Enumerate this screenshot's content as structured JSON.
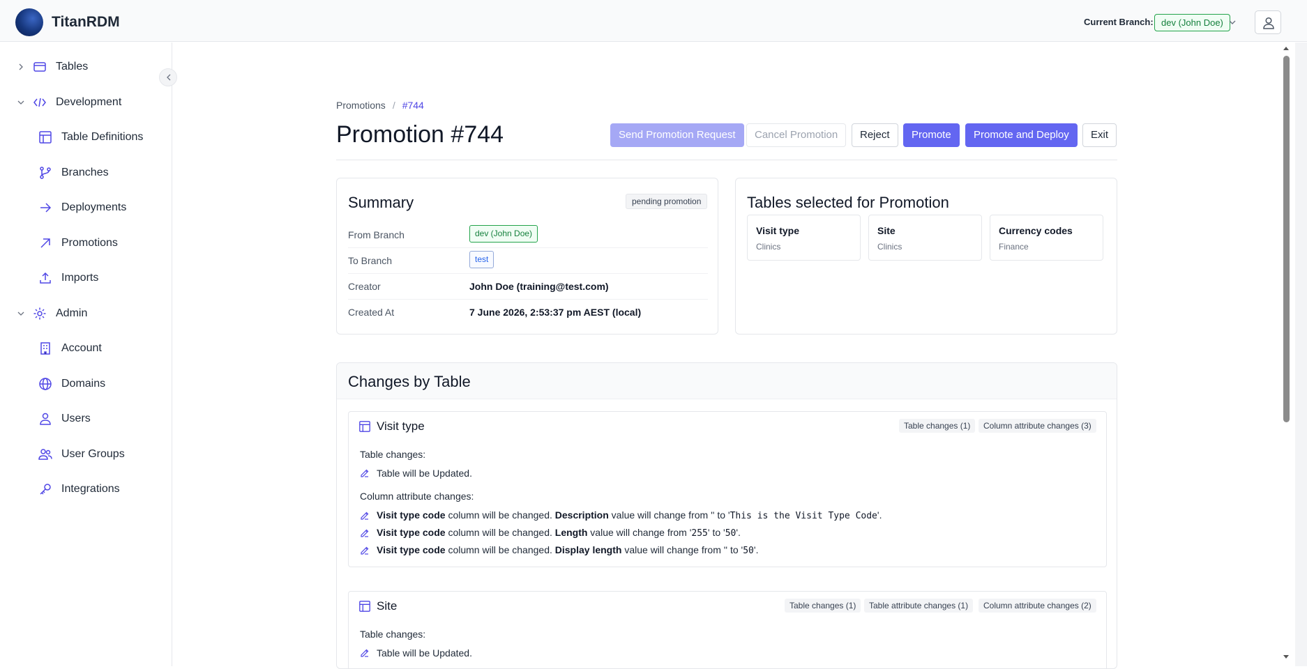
{
  "app": {
    "brand": "TitanRDM"
  },
  "header": {
    "current_branch_label": "Current Branch:",
    "current_branch_value": "dev (John Doe)"
  },
  "sidebar": {
    "items": [
      {
        "label": "Tables",
        "icon": "table-icon"
      },
      {
        "label": "Development",
        "icon": "code-icon"
      },
      {
        "label": "Table Definitions",
        "icon": "table-grid-icon"
      },
      {
        "label": "Branches",
        "icon": "git-branch-icon"
      },
      {
        "label": "Deployments",
        "icon": "arrow-right-icon"
      },
      {
        "label": "Promotions",
        "icon": "arrow-up-right-icon"
      },
      {
        "label": "Imports",
        "icon": "upload-icon"
      },
      {
        "label": "Admin",
        "icon": "gear-icon"
      },
      {
        "label": "Account",
        "icon": "building-icon"
      },
      {
        "label": "Domains",
        "icon": "globe-icon"
      },
      {
        "label": "Users",
        "icon": "user-icon"
      },
      {
        "label": "User Groups",
        "icon": "users-icon"
      },
      {
        "label": "Integrations",
        "icon": "key-icon"
      }
    ]
  },
  "breadcrumb": {
    "parent": "Promotions",
    "sep": "/",
    "current": "#744"
  },
  "page": {
    "title": "Promotion #744"
  },
  "actions": {
    "send": "Send Promotion Request",
    "cancel": "Cancel Promotion",
    "reject": "Reject",
    "promote": "Promote",
    "promote_deploy": "Promote and Deploy",
    "exit": "Exit"
  },
  "summary": {
    "title": "Summary",
    "status": "pending promotion",
    "rows": [
      {
        "key": "From Branch",
        "value": "dev (John Doe)"
      },
      {
        "key": "To Branch",
        "value": "test"
      },
      {
        "key": "Creator",
        "value": "John Doe (training@test.com)"
      },
      {
        "key": "Created At",
        "value": "7 June 2026, 2:53:37 pm AEST (local)"
      }
    ]
  },
  "selected_tables": {
    "title": "Tables selected for Promotion",
    "tables": [
      {
        "name": "Visit type",
        "domain": "Clinics"
      },
      {
        "name": "Site",
        "domain": "Clinics"
      },
      {
        "name": "Currency codes",
        "domain": "Finance"
      }
    ]
  },
  "changes": {
    "title": "Changes by Table",
    "tables": [
      {
        "name": "Visit type",
        "pills": [
          "Table changes (1)",
          "Column attribute changes (3)"
        ],
        "table_changes_label": "Table changes:",
        "table_changes": [
          "Table will be Updated."
        ],
        "column_changes_label": "Column attribute changes:",
        "column_changes": [
          {
            "column": "Visit type code",
            "mid": " column will be changed. ",
            "attr": "Description",
            "pre": " value will change from '",
            "from": "",
            "to_sep": "' to '",
            "to": "This is the Visit Type Code",
            "end": "'."
          },
          {
            "column": "Visit type code",
            "mid": " column will be changed. ",
            "attr": "Length",
            "pre": " value will change from '",
            "from": "255",
            "to_sep": "' to '",
            "to": "50",
            "end": "'."
          },
          {
            "column": "Visit type code",
            "mid": " column will be changed. ",
            "attr": "Display length",
            "pre": " value will change from '",
            "from": "",
            "to_sep": "' to '",
            "to": "50",
            "end": "'."
          }
        ]
      },
      {
        "name": "Site",
        "pills": [
          "Table changes (1)",
          "Table attribute changes (1)",
          "Column attribute changes (2)"
        ],
        "table_changes_label": "Table changes:",
        "table_changes": [
          "Table will be Updated."
        ]
      }
    ]
  },
  "colors": {
    "accent": "#6366f1",
    "branch_green": "#15803d",
    "branch_blue": "#2563eb"
  }
}
